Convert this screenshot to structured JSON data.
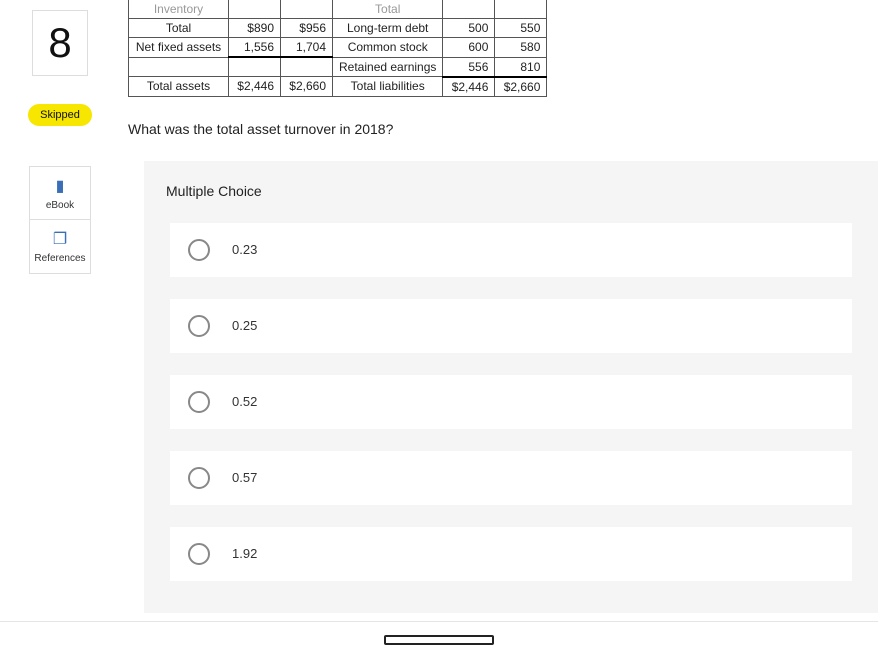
{
  "sidebar": {
    "question_number": "8",
    "skipped_label": "Skipped",
    "ebook_label": "eBook",
    "references_label": "References"
  },
  "balance_sheet": {
    "cut_left_label": "Inventory",
    "cut_right_label": "Total",
    "rows": [
      {
        "label_left": "Total",
        "col1": "$890",
        "col2": "$956",
        "label_right": "Long-term debt",
        "col3": "500",
        "col4": "550"
      },
      {
        "label_left": "Net fixed assets",
        "col1": "1,556",
        "col2": "1,704",
        "label_right": "Common stock",
        "col3": "600",
        "col4": "580"
      },
      {
        "label_left": "",
        "col1": "",
        "col2": "",
        "label_right": "Retained earnings",
        "col3": "556",
        "col4": "810"
      },
      {
        "label_left": "Total assets",
        "col1": "$2,446",
        "col2": "$2,660",
        "label_right": "Total liabilities",
        "col3": "$2,446",
        "col4": "$2,660"
      }
    ]
  },
  "question": {
    "text": "What was the total asset turnover in 2018?"
  },
  "multiple_choice": {
    "title": "Multiple Choice",
    "options": [
      {
        "label": "0.23"
      },
      {
        "label": "0.25"
      },
      {
        "label": "0.52"
      },
      {
        "label": "0.57"
      },
      {
        "label": "1.92"
      }
    ]
  }
}
